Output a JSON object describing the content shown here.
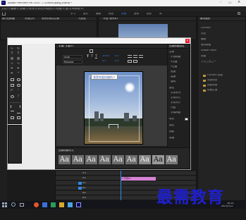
{
  "window": {
    "title": "Adobe Premiere Pro 2020 - C:\\Users\\未命名.prproj *",
    "controls": [
      "–",
      "□",
      "×"
    ]
  },
  "menu": [
    "文件(F)",
    "编辑(E)",
    "剪辑(C)",
    "序列(S)",
    "标记(M)",
    "图形(G)",
    "视图(V)",
    "窗口(W)",
    "帮助(H)"
  ],
  "workspaces": [
    "学习",
    "组件",
    "编辑",
    "颜色",
    "效果",
    "音频",
    "图形",
    "库"
  ],
  "source_panel": {
    "tabs": [
      "源:(无剪辑)",
      "效果控件",
      "音频剪辑混合器",
      "元数据"
    ]
  },
  "program_panel": {
    "tab": "节目: 序列01"
  },
  "right_panel": {
    "tabs": [
      "基本图形",
      "Lumetri"
    ],
    "items": [
      "浏览",
      "编辑",
      "我的模板",
      "Adobe Stock",
      "标题",
      "下方三分之一",
      "Lumetri 颜色",
      "效果预设",
      "视频效果",
      "视频过渡"
    ]
  },
  "titler": {
    "header": "字幕: 字幕01",
    "font": "Arial",
    "font_style": "Regular",
    "size": "100.0",
    "kerning": "0.0",
    "leading": "0.0",
    "tracking": "0.0",
    "title_text": "我是热爱拍摄的人",
    "styles_header": "旧版标题样式",
    "style_glyph": "Aa",
    "properties_header": "旧版标题属性",
    "properties": [
      "变换",
      "不透明度",
      "X位置",
      "Y位置",
      "宽度",
      "高度",
      "旋转",
      "属性",
      "字体系列",
      "字体样式",
      "字体大小",
      "行距",
      "字偶间距",
      "填充",
      "描边",
      "阴影",
      "背景"
    ]
  },
  "timeline": {
    "tracks": [
      "V3",
      "V2",
      "V1",
      "A1",
      "A2",
      "A3"
    ],
    "clip_label": "fx 字幕01"
  },
  "taskbar": {
    "time": "10:21",
    "date": "2021/7/12"
  },
  "watermark": "最需教育",
  "colors": {
    "accent": "#2d8ceb",
    "clip_pink": "#d783d6",
    "title_text_bg": "#ffffff",
    "close_red": "#e81123"
  }
}
